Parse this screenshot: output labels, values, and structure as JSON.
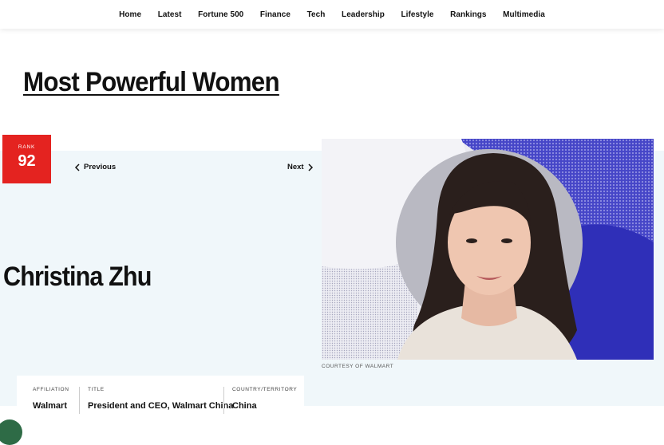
{
  "nav": {
    "items": [
      "Home",
      "Latest",
      "Fortune 500",
      "Finance",
      "Tech",
      "Leadership",
      "Lifestyle",
      "Rankings",
      "Multimedia"
    ]
  },
  "page": {
    "title": "Most Powerful Women"
  },
  "rank": {
    "label": "RANK",
    "number": "92"
  },
  "pager": {
    "previous": "Previous",
    "next": "Next"
  },
  "person": {
    "name": "Christina Zhu"
  },
  "photo": {
    "credit": "COURTESY OF WALMART"
  },
  "info": {
    "affiliation_label": "AFFILIATION",
    "affiliation": "Walmart",
    "title_label": "TITLE",
    "title": "President and CEO, Walmart China",
    "country_label": "COUNTRY/TERRITORY",
    "country": "China"
  },
  "colors": {
    "rank_red": "#e42320",
    "band": "#f0f7fa",
    "photo_blue": "#2f2fb8",
    "badge_green": "#2e6b46"
  }
}
